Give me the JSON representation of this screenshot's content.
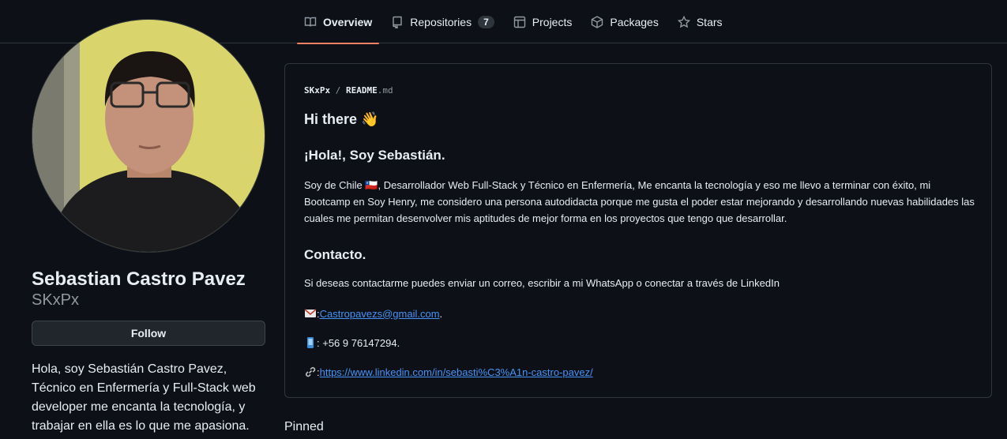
{
  "nav": {
    "tabs": [
      {
        "label": "Overview",
        "icon": "book-icon"
      },
      {
        "label": "Repositories",
        "icon": "repo-icon",
        "count": "7"
      },
      {
        "label": "Projects",
        "icon": "table-icon"
      },
      {
        "label": "Packages",
        "icon": "package-icon"
      },
      {
        "label": "Stars",
        "icon": "star-icon"
      }
    ]
  },
  "profile": {
    "name": "Sebastian Castro Pavez",
    "login": "SKxPx",
    "follow_label": "Follow",
    "bio": "Hola, soy Sebastián Castro Pavez, Técnico en Enfermería y Full-Stack web developer me encanta la tecnología, y trabajar en ella es lo que me apasiona."
  },
  "readme": {
    "owner": "SKxPx",
    "sep": " / ",
    "file": "README",
    "ext": ".md",
    "greeting": "Hi there 👋",
    "heading": "¡Hola!, Soy Sebastián.",
    "intro": "Soy de Chile 🇨🇱, Desarrollador Web Full-Stack y Técnico en Enfermería, Me encanta la tecnología y eso me llevo a terminar con éxito, mi Bootcamp en Soy Henry, me considero una persona autodidacta porque me gusta el poder estar mejorando y desarrollando nuevas habilidades las cuales me permitan desenvolver mis aptitudes de mejor forma en los proyectos que tengo que desarrollar.",
    "contact_heading": "Contacto.",
    "contact_text": "Si deseas contactarme puedes enviar un correo, escribir a mi WhatsApp o conectar a través de LinkedIn",
    "email_prefix": ": ",
    "email": "Castropavezs@gmail.com",
    "email_suffix": ".",
    "phone": ": +56 9 76147294.",
    "linkedin_prefix": ": ",
    "linkedin": "https://www.linkedin.com/in/sebasti%C3%A1n-castro-pavez/"
  },
  "pinned_label": "Pinned",
  "colors": {
    "accent": "#f78166",
    "link": "#4493f8",
    "bg": "#0d1117"
  }
}
